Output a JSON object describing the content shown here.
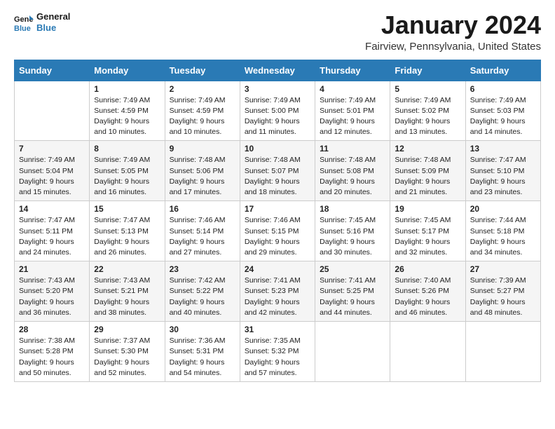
{
  "logo": {
    "line1": "General",
    "line2": "Blue"
  },
  "title": "January 2024",
  "location": "Fairview, Pennsylvania, United States",
  "weekdays": [
    "Sunday",
    "Monday",
    "Tuesday",
    "Wednesday",
    "Thursday",
    "Friday",
    "Saturday"
  ],
  "weeks": [
    [
      {
        "day": "",
        "sunrise": "",
        "sunset": "",
        "daylight": ""
      },
      {
        "day": "1",
        "sunrise": "Sunrise: 7:49 AM",
        "sunset": "Sunset: 4:59 PM",
        "daylight": "Daylight: 9 hours and 10 minutes."
      },
      {
        "day": "2",
        "sunrise": "Sunrise: 7:49 AM",
        "sunset": "Sunset: 4:59 PM",
        "daylight": "Daylight: 9 hours and 10 minutes."
      },
      {
        "day": "3",
        "sunrise": "Sunrise: 7:49 AM",
        "sunset": "Sunset: 5:00 PM",
        "daylight": "Daylight: 9 hours and 11 minutes."
      },
      {
        "day": "4",
        "sunrise": "Sunrise: 7:49 AM",
        "sunset": "Sunset: 5:01 PM",
        "daylight": "Daylight: 9 hours and 12 minutes."
      },
      {
        "day": "5",
        "sunrise": "Sunrise: 7:49 AM",
        "sunset": "Sunset: 5:02 PM",
        "daylight": "Daylight: 9 hours and 13 minutes."
      },
      {
        "day": "6",
        "sunrise": "Sunrise: 7:49 AM",
        "sunset": "Sunset: 5:03 PM",
        "daylight": "Daylight: 9 hours and 14 minutes."
      }
    ],
    [
      {
        "day": "7",
        "sunrise": "Sunrise: 7:49 AM",
        "sunset": "Sunset: 5:04 PM",
        "daylight": "Daylight: 9 hours and 15 minutes."
      },
      {
        "day": "8",
        "sunrise": "Sunrise: 7:49 AM",
        "sunset": "Sunset: 5:05 PM",
        "daylight": "Daylight: 9 hours and 16 minutes."
      },
      {
        "day": "9",
        "sunrise": "Sunrise: 7:48 AM",
        "sunset": "Sunset: 5:06 PM",
        "daylight": "Daylight: 9 hours and 17 minutes."
      },
      {
        "day": "10",
        "sunrise": "Sunrise: 7:48 AM",
        "sunset": "Sunset: 5:07 PM",
        "daylight": "Daylight: 9 hours and 18 minutes."
      },
      {
        "day": "11",
        "sunrise": "Sunrise: 7:48 AM",
        "sunset": "Sunset: 5:08 PM",
        "daylight": "Daylight: 9 hours and 20 minutes."
      },
      {
        "day": "12",
        "sunrise": "Sunrise: 7:48 AM",
        "sunset": "Sunset: 5:09 PM",
        "daylight": "Daylight: 9 hours and 21 minutes."
      },
      {
        "day": "13",
        "sunrise": "Sunrise: 7:47 AM",
        "sunset": "Sunset: 5:10 PM",
        "daylight": "Daylight: 9 hours and 23 minutes."
      }
    ],
    [
      {
        "day": "14",
        "sunrise": "Sunrise: 7:47 AM",
        "sunset": "Sunset: 5:11 PM",
        "daylight": "Daylight: 9 hours and 24 minutes."
      },
      {
        "day": "15",
        "sunrise": "Sunrise: 7:47 AM",
        "sunset": "Sunset: 5:13 PM",
        "daylight": "Daylight: 9 hours and 26 minutes."
      },
      {
        "day": "16",
        "sunrise": "Sunrise: 7:46 AM",
        "sunset": "Sunset: 5:14 PM",
        "daylight": "Daylight: 9 hours and 27 minutes."
      },
      {
        "day": "17",
        "sunrise": "Sunrise: 7:46 AM",
        "sunset": "Sunset: 5:15 PM",
        "daylight": "Daylight: 9 hours and 29 minutes."
      },
      {
        "day": "18",
        "sunrise": "Sunrise: 7:45 AM",
        "sunset": "Sunset: 5:16 PM",
        "daylight": "Daylight: 9 hours and 30 minutes."
      },
      {
        "day": "19",
        "sunrise": "Sunrise: 7:45 AM",
        "sunset": "Sunset: 5:17 PM",
        "daylight": "Daylight: 9 hours and 32 minutes."
      },
      {
        "day": "20",
        "sunrise": "Sunrise: 7:44 AM",
        "sunset": "Sunset: 5:18 PM",
        "daylight": "Daylight: 9 hours and 34 minutes."
      }
    ],
    [
      {
        "day": "21",
        "sunrise": "Sunrise: 7:43 AM",
        "sunset": "Sunset: 5:20 PM",
        "daylight": "Daylight: 9 hours and 36 minutes."
      },
      {
        "day": "22",
        "sunrise": "Sunrise: 7:43 AM",
        "sunset": "Sunset: 5:21 PM",
        "daylight": "Daylight: 9 hours and 38 minutes."
      },
      {
        "day": "23",
        "sunrise": "Sunrise: 7:42 AM",
        "sunset": "Sunset: 5:22 PM",
        "daylight": "Daylight: 9 hours and 40 minutes."
      },
      {
        "day": "24",
        "sunrise": "Sunrise: 7:41 AM",
        "sunset": "Sunset: 5:23 PM",
        "daylight": "Daylight: 9 hours and 42 minutes."
      },
      {
        "day": "25",
        "sunrise": "Sunrise: 7:41 AM",
        "sunset": "Sunset: 5:25 PM",
        "daylight": "Daylight: 9 hours and 44 minutes."
      },
      {
        "day": "26",
        "sunrise": "Sunrise: 7:40 AM",
        "sunset": "Sunset: 5:26 PM",
        "daylight": "Daylight: 9 hours and 46 minutes."
      },
      {
        "day": "27",
        "sunrise": "Sunrise: 7:39 AM",
        "sunset": "Sunset: 5:27 PM",
        "daylight": "Daylight: 9 hours and 48 minutes."
      }
    ],
    [
      {
        "day": "28",
        "sunrise": "Sunrise: 7:38 AM",
        "sunset": "Sunset: 5:28 PM",
        "daylight": "Daylight: 9 hours and 50 minutes."
      },
      {
        "day": "29",
        "sunrise": "Sunrise: 7:37 AM",
        "sunset": "Sunset: 5:30 PM",
        "daylight": "Daylight: 9 hours and 52 minutes."
      },
      {
        "day": "30",
        "sunrise": "Sunrise: 7:36 AM",
        "sunset": "Sunset: 5:31 PM",
        "daylight": "Daylight: 9 hours and 54 minutes."
      },
      {
        "day": "31",
        "sunrise": "Sunrise: 7:35 AM",
        "sunset": "Sunset: 5:32 PM",
        "daylight": "Daylight: 9 hours and 57 minutes."
      },
      {
        "day": "",
        "sunrise": "",
        "sunset": "",
        "daylight": ""
      },
      {
        "day": "",
        "sunrise": "",
        "sunset": "",
        "daylight": ""
      },
      {
        "day": "",
        "sunrise": "",
        "sunset": "",
        "daylight": ""
      }
    ]
  ]
}
